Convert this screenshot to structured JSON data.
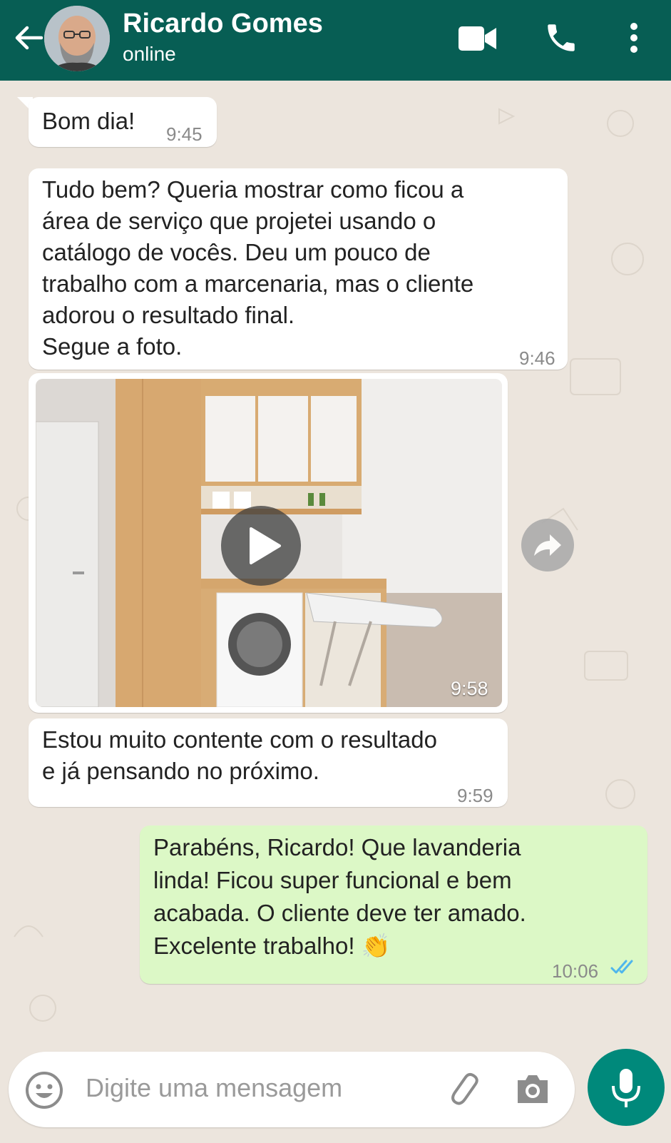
{
  "header": {
    "contact_name": "Ricardo Gomes",
    "status": "online",
    "icons": [
      "back-arrow-icon",
      "video-call-icon",
      "phone-icon",
      "more-options-icon"
    ],
    "background_color": "#075e54"
  },
  "messages": [
    {
      "direction": "in",
      "text": "Bom dia!",
      "time": "9:45"
    },
    {
      "direction": "in",
      "text": "Tudo bem? Queria mostrar como ficou a\nárea de serviço que projetei usando o\ncatálogo de vocês. Deu um pouco de\ntrabalho com a marcenaria, mas o cliente\nadorou o resultado final.\nSegue a foto.",
      "time": "9:46"
    },
    {
      "direction": "in",
      "type": "video",
      "time": "9:58"
    },
    {
      "direction": "in",
      "text": "Estou muito contente com o resultado\ne já pensando no próximo.",
      "time": "9:59"
    },
    {
      "direction": "out",
      "text": "Parabéns, Ricardo! Que lavanderia\nlinda! Ficou super funcional e bem\nacabada. O cliente deve ter amado.\nExcelente trabalho! 👏",
      "time": "10:06",
      "status": "read"
    }
  ],
  "composer": {
    "placeholder": "Digite uma mensagem",
    "icons": [
      "emoji-icon",
      "attach-icon",
      "camera-icon",
      "mic-icon"
    ],
    "mic_color": "#00897b"
  },
  "colors": {
    "chat_background": "#ece5dd",
    "incoming_bubble": "#ffffff",
    "outgoing_bubble": "#dcf8c6",
    "read_ticks": "#4fb6ec"
  }
}
